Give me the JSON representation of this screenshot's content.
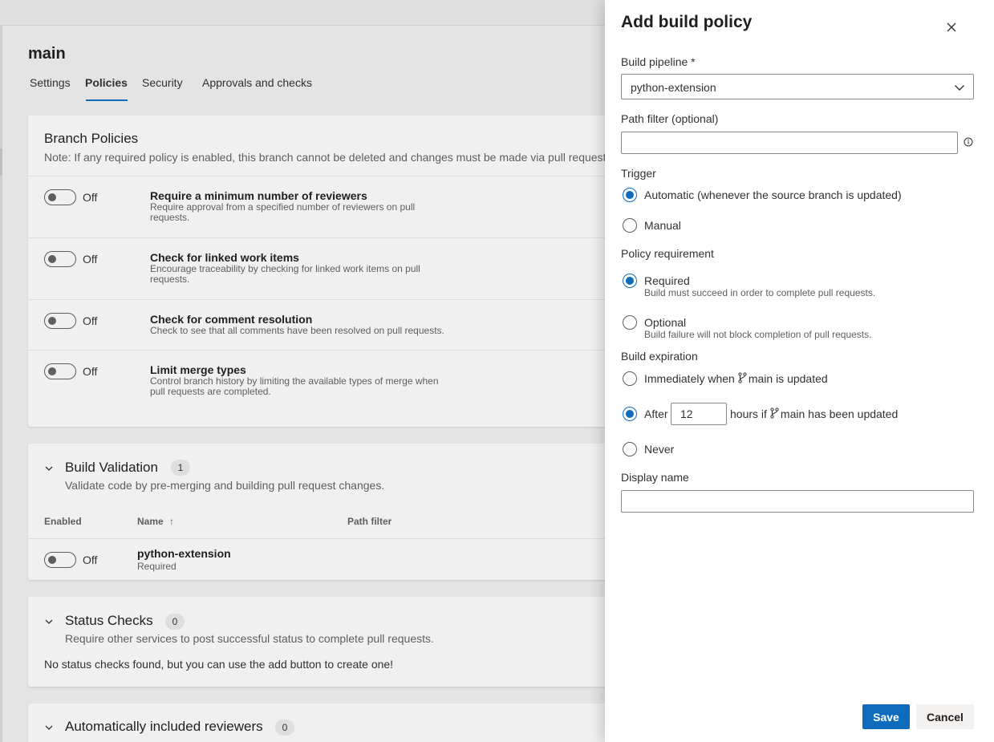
{
  "background": {
    "branch_name": "main",
    "tabs": [
      {
        "label": "Settings"
      },
      {
        "label": "Policies"
      },
      {
        "label": "Security"
      },
      {
        "label": "Approvals and checks"
      }
    ],
    "branch_policies": {
      "title": "Branch Policies",
      "note": "Note: If any required policy is enabled, this branch cannot be deleted and changes must be made via pull request.",
      "items": [
        {
          "state": "Off",
          "title": "Require a minimum number of reviewers",
          "desc": "Require approval from a specified number of reviewers on pull requests."
        },
        {
          "state": "Off",
          "title": "Check for linked work items",
          "desc": "Encourage traceability by checking for linked work items on pull requests."
        },
        {
          "state": "Off",
          "title": "Check for comment resolution",
          "desc": "Check to see that all comments have been resolved on pull requests."
        },
        {
          "state": "Off",
          "title": "Limit merge types",
          "desc": "Control branch history by limiting the available types of merge when pull requests are completed."
        }
      ]
    },
    "build_validation": {
      "title": "Build Validation",
      "count": "1",
      "desc": "Validate code by pre-merging and building pull request changes.",
      "columns": {
        "enabled": "Enabled",
        "name": "Name",
        "sort_glyph": "↑",
        "path_filter": "Path filter"
      },
      "rows": [
        {
          "state": "Off",
          "name": "python-extension",
          "requirement": "Required"
        }
      ]
    },
    "status_checks": {
      "title": "Status Checks",
      "count": "0",
      "desc": "Require other services to post successful status to complete pull requests.",
      "empty": "No status checks found, but you can use the add button to create one!"
    },
    "auto_reviewers": {
      "title": "Automatically included reviewers",
      "count": "0"
    }
  },
  "panel": {
    "title": "Add build policy",
    "close_icon": "close-icon",
    "pipeline": {
      "label": "Build pipeline *",
      "value": "python-extension"
    },
    "path_filter": {
      "label": "Path filter (optional)",
      "value": ""
    },
    "trigger": {
      "label": "Trigger",
      "options": [
        {
          "label": "Automatic (whenever the source branch is updated)",
          "checked": true
        },
        {
          "label": "Manual",
          "checked": false
        }
      ]
    },
    "requirement": {
      "label": "Policy requirement",
      "options": [
        {
          "label": "Required",
          "sub": "Build must succeed in order to complete pull requests.",
          "checked": true
        },
        {
          "label": "Optional",
          "sub": "Build failure will not block completion of pull requests.",
          "checked": false
        }
      ]
    },
    "expiration": {
      "label": "Build expiration",
      "immediately_prefix": "Immediately when",
      "immediately_suffix": "main is updated",
      "after_prefix": "After",
      "hours_value": "12",
      "after_suffix_a": "hours if",
      "after_suffix_b": "main has been updated",
      "never": "Never",
      "selected": "after"
    },
    "display_name": {
      "label": "Display name",
      "value": ""
    },
    "buttons": {
      "save": "Save",
      "cancel": "Cancel"
    },
    "colors": {
      "accent": "#0f6cbd"
    }
  }
}
